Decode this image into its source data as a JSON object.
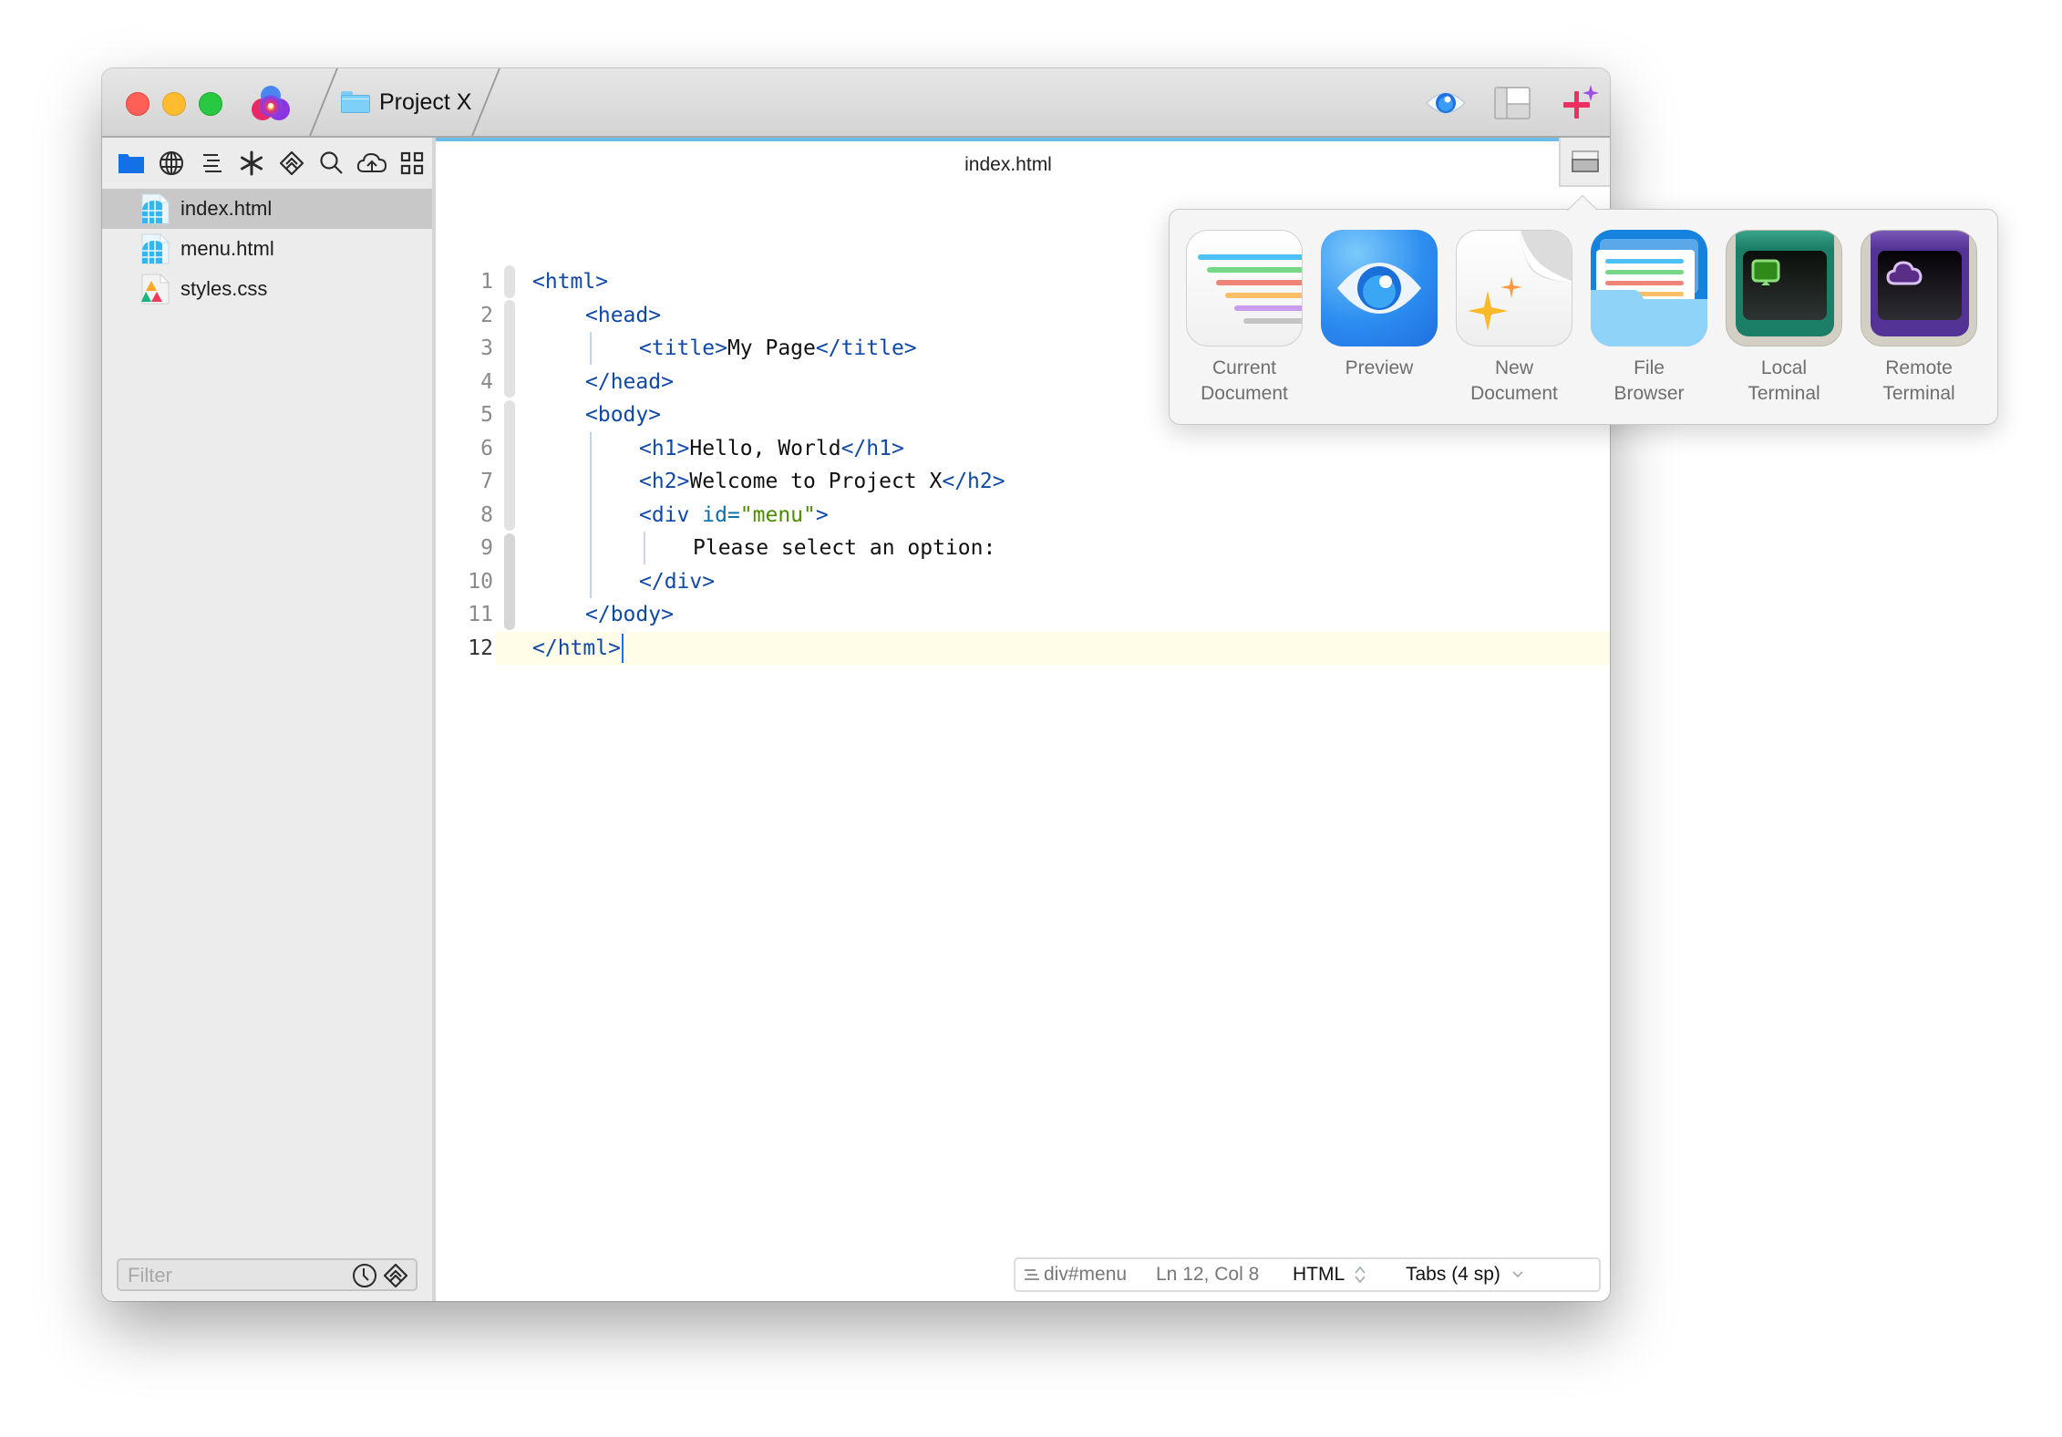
{
  "window": {
    "project_name": "Project X"
  },
  "titlebar": {
    "icons": [
      "app-logo-icon",
      "preview-eye-icon",
      "layout-panel-icon",
      "sparkle-plus-icon"
    ]
  },
  "sidebar": {
    "tools": [
      "folder-icon",
      "globe-icon",
      "outline-icon",
      "asterisk-icon",
      "git-diamond-icon",
      "search-icon",
      "cloud-upload-icon",
      "grid-icon"
    ],
    "files": [
      {
        "name": "index.html",
        "type": "html",
        "selected": true
      },
      {
        "name": "menu.html",
        "type": "html",
        "selected": false
      },
      {
        "name": "styles.css",
        "type": "css",
        "selected": false
      }
    ],
    "filter_placeholder": "Filter",
    "filter_value": ""
  },
  "editor": {
    "document_title": "index.html",
    "current_line": 12,
    "lines": [
      {
        "n": "1"
      },
      {
        "n": "2"
      },
      {
        "n": "3"
      },
      {
        "n": "4"
      },
      {
        "n": "5"
      },
      {
        "n": "6"
      },
      {
        "n": "7"
      },
      {
        "n": "8"
      },
      {
        "n": "9"
      },
      {
        "n": "10"
      },
      {
        "n": "11"
      },
      {
        "n": "12"
      }
    ],
    "code": {
      "l1_open": "<html>",
      "l2_open": "<head>",
      "l3_open": "<title>",
      "l3_text": "My Page",
      "l3_close": "</title>",
      "l4_close": "</head>",
      "l5_open": "<body>",
      "l6_open": "<h1>",
      "l6_text": "Hello, World",
      "l6_close": "</h1>",
      "l7_open": "<h2>",
      "l7_text": "Welcome to Project X",
      "l7_close": "</h2>",
      "l8_tag": "<div",
      "l8_attr": "id=",
      "l8_str": "\"menu\"",
      "l8_end": ">",
      "l9_text": "Please select an option:",
      "l10_close": "</div>",
      "l11_close": "</body>",
      "l12_close": "</html>"
    }
  },
  "statusbar": {
    "breadcrumb": "div#menu",
    "position": "Ln 12, Col 8",
    "syntax": "HTML",
    "indentation": "Tabs (4 sp)"
  },
  "popover": {
    "items": [
      {
        "label_line1": "Current",
        "label_line2": "Document"
      },
      {
        "label_line1": "Preview",
        "label_line2": ""
      },
      {
        "label_line1": "New",
        "label_line2": "Document"
      },
      {
        "label_line1": "File",
        "label_line2": "Browser"
      },
      {
        "label_line1": "Local",
        "label_line2": "Terminal"
      },
      {
        "label_line1": "Remote",
        "label_line2": "Terminal"
      }
    ]
  },
  "colors": {
    "accent_blue": "#6bbde8",
    "tag": "#0f48a8",
    "attribute": "#0d6fa8",
    "string": "#4d8a00",
    "current_line": "#fffde8",
    "caret": "#1a73e8"
  }
}
